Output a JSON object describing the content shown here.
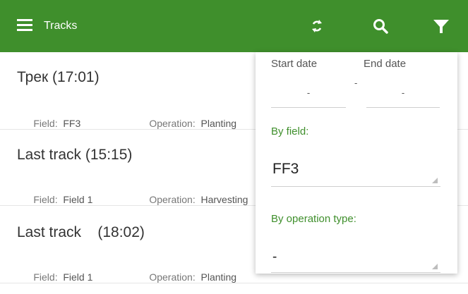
{
  "header": {
    "title": "Tracks",
    "icons": [
      "menu-icon",
      "sync-icon",
      "search-icon",
      "filter-icon"
    ],
    "color": "#3f8f2c"
  },
  "tracks": [
    {
      "title": "Трек (17:01)",
      "field_label": "Field:",
      "field": "FF3",
      "op_label": "Operation:",
      "operation": "Planting"
    },
    {
      "title": "Last track (15:15)",
      "field_label": "Field:",
      "field": "Field 1",
      "op_label": "Operation:",
      "operation": "Harvesting"
    },
    {
      "title": "Last track    (18:02)",
      "field_label": "Field:",
      "field": "Field 1",
      "op_label": "Operation:",
      "operation": "Planting"
    }
  ],
  "filter": {
    "start_label": "Start date",
    "end_label": "End date",
    "start_value": "-",
    "end_value": "-",
    "separator": "-",
    "by_field_label": "By field:",
    "field_value": "FF3",
    "by_operation_label": "By operation type:",
    "operation_value": "-"
  }
}
